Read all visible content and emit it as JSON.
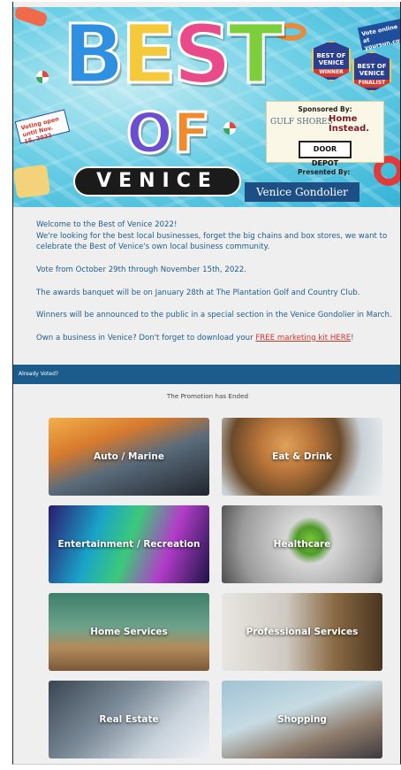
{
  "banner": {
    "title_letters": [
      "B",
      "E",
      "S",
      "T"
    ],
    "title_colors": [
      "#2f8fe0",
      "#f4c93a",
      "#e84a8a",
      "#7ccf3b"
    ],
    "of_letters": [
      "O",
      "F"
    ],
    "of_colors": [
      "#6b4fd1",
      "#f08a2a"
    ],
    "city": "VENICE",
    "badge_winner": "BEST OF VENICE",
    "badge_winner_ribbon": "WINNER",
    "badge_finalist": "BEST OF VENICE",
    "badge_finalist_ribbon": "FINALIST",
    "vote_online": "Vote online at yoursun.com",
    "voting_open": "Voting open until Nov. 15, 2022",
    "sponsored_by": "Sponsored By:",
    "sponsor_gulf": "GULF SHORES",
    "sponsor_home": "Home Instead.",
    "sponsor_door": "DOOR DEPOT",
    "presented_by": "Presented By:",
    "presenter": "Venice Gondolier"
  },
  "intro": {
    "p1_line1": "Welcome to the Best of Venice 2022!",
    "p1_line2": "We're looking for the best local businesses, forget the big chains and box stores, we want to celebrate the Best of Venice's own local business community.",
    "p2": "Vote from October 29th through November 15th, 2022.",
    "p3": "The awards banquet will be on January 28th at The Plantation Golf and Country Club.",
    "p4": "Winners will be announced to the public in a special section in the Venice Gondolier in March.",
    "p5_prefix": "Own a business in Venice? Don't forget to download your ",
    "p5_link": "FREE marketing kit HERE",
    "p5_suffix": "!"
  },
  "voted_bar": "Already Voted?",
  "promotion_status": "The Promotion has Ended",
  "categories": [
    {
      "label": "Auto / Marine"
    },
    {
      "label": "Eat & Drink"
    },
    {
      "label": "Entertainment / Recreation"
    },
    {
      "label": "Healthcare"
    },
    {
      "label": "Home Services"
    },
    {
      "label": "Professional Services"
    },
    {
      "label": "Real Estate"
    },
    {
      "label": "Shopping"
    }
  ]
}
